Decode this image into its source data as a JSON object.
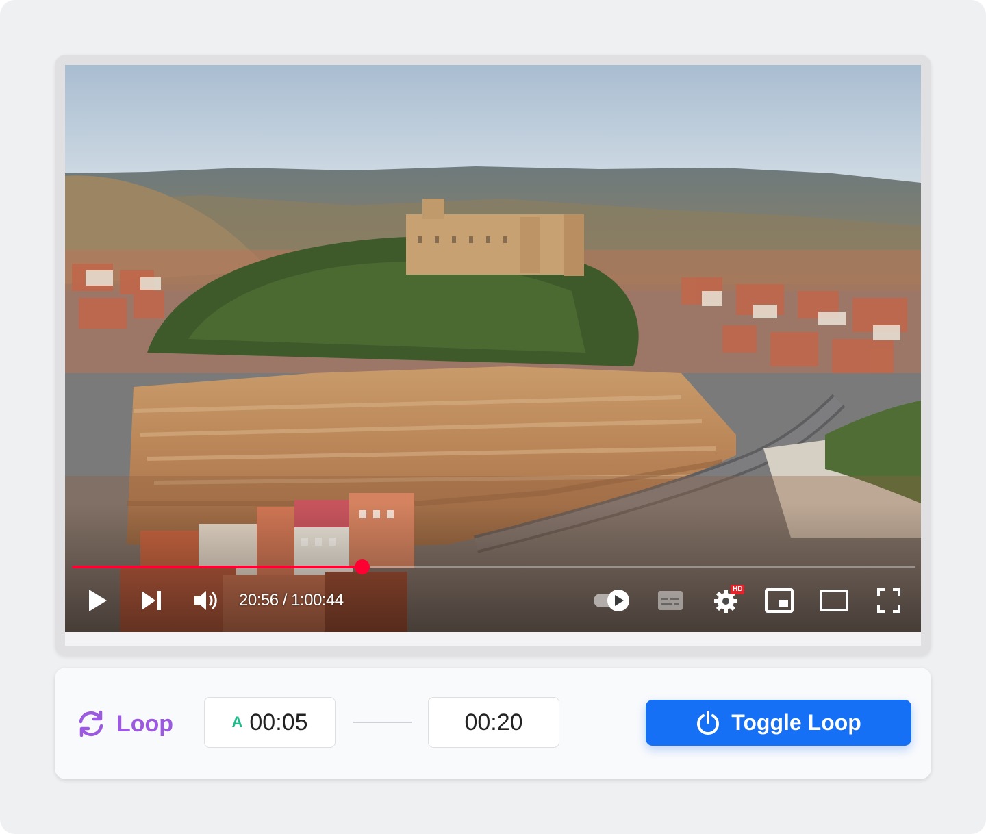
{
  "player": {
    "time_current": "20:56",
    "time_total": "1:00:44",
    "time_separator": " / ",
    "progress_fraction": 0.344,
    "hd_badge": "HD",
    "progress_color": "#ff0033",
    "icons": [
      "play-icon",
      "next-icon",
      "volume-icon",
      "autoplay-toggle-icon",
      "subtitles-icon",
      "settings-icon",
      "miniplayer-icon",
      "theater-icon",
      "fullscreen-icon"
    ]
  },
  "loop": {
    "label": "Loop",
    "label_color": "#9b5ae0",
    "start_marker": "A",
    "start_time": "00:05",
    "end_time": "00:20",
    "toggle_label": "Toggle Loop",
    "button_color": "#1570f5"
  }
}
